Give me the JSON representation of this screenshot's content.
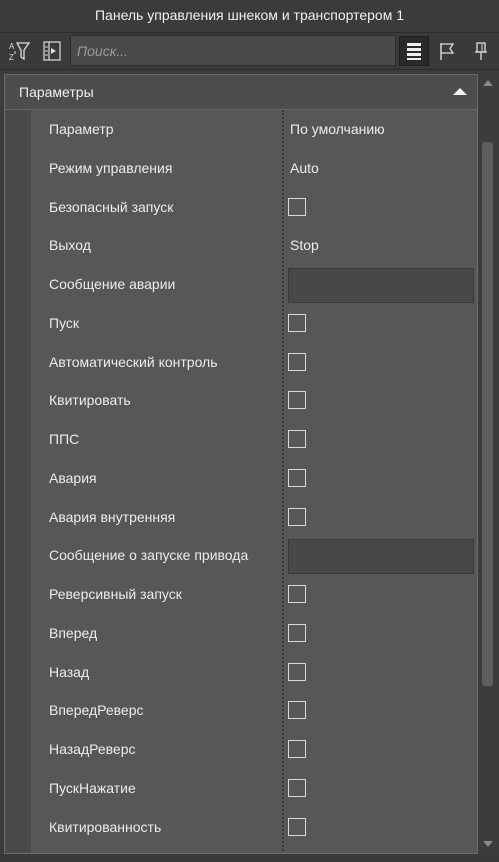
{
  "window": {
    "title": "Панель управления шнеком и транспортером 1"
  },
  "toolbar": {
    "search_placeholder": "Поиск...",
    "icons": [
      "sort-filter-icon",
      "expand-icon",
      "list-view-icon",
      "flag-icon",
      "pin-icon"
    ]
  },
  "section": {
    "title": "Параметры",
    "collapsed": false
  },
  "rows": [
    {
      "label": "Параметр",
      "type": "text",
      "value": "По умолчанию"
    },
    {
      "label": "Режим управления",
      "type": "text",
      "value": "Auto"
    },
    {
      "label": "Безопасный запуск",
      "type": "checkbox",
      "checked": false
    },
    {
      "label": "Выход",
      "type": "text",
      "value": "Stop"
    },
    {
      "label": "Сообщение аварии",
      "type": "textbox",
      "value": ""
    },
    {
      "label": "Пуск",
      "type": "checkbox",
      "checked": false
    },
    {
      "label": "Автоматический контроль",
      "type": "checkbox",
      "checked": false
    },
    {
      "label": "Квитировать",
      "type": "checkbox",
      "checked": false
    },
    {
      "label": "ППС",
      "type": "checkbox",
      "checked": false
    },
    {
      "label": "Авария",
      "type": "checkbox",
      "checked": false
    },
    {
      "label": "Авария внутренняя",
      "type": "checkbox",
      "checked": false
    },
    {
      "label": "Сообщение о запуске привода",
      "type": "textbox",
      "value": ""
    },
    {
      "label": "Реверсивный запуск",
      "type": "checkbox",
      "checked": false
    },
    {
      "label": "Вперед",
      "type": "checkbox",
      "checked": false
    },
    {
      "label": "Назад",
      "type": "checkbox",
      "checked": false
    },
    {
      "label": "ВпередРеверс",
      "type": "checkbox",
      "checked": false
    },
    {
      "label": "НазадРеверс",
      "type": "checkbox",
      "checked": false
    },
    {
      "label": "ПускНажатие",
      "type": "checkbox",
      "checked": false
    },
    {
      "label": "Квитированность",
      "type": "checkbox",
      "checked": false
    }
  ]
}
